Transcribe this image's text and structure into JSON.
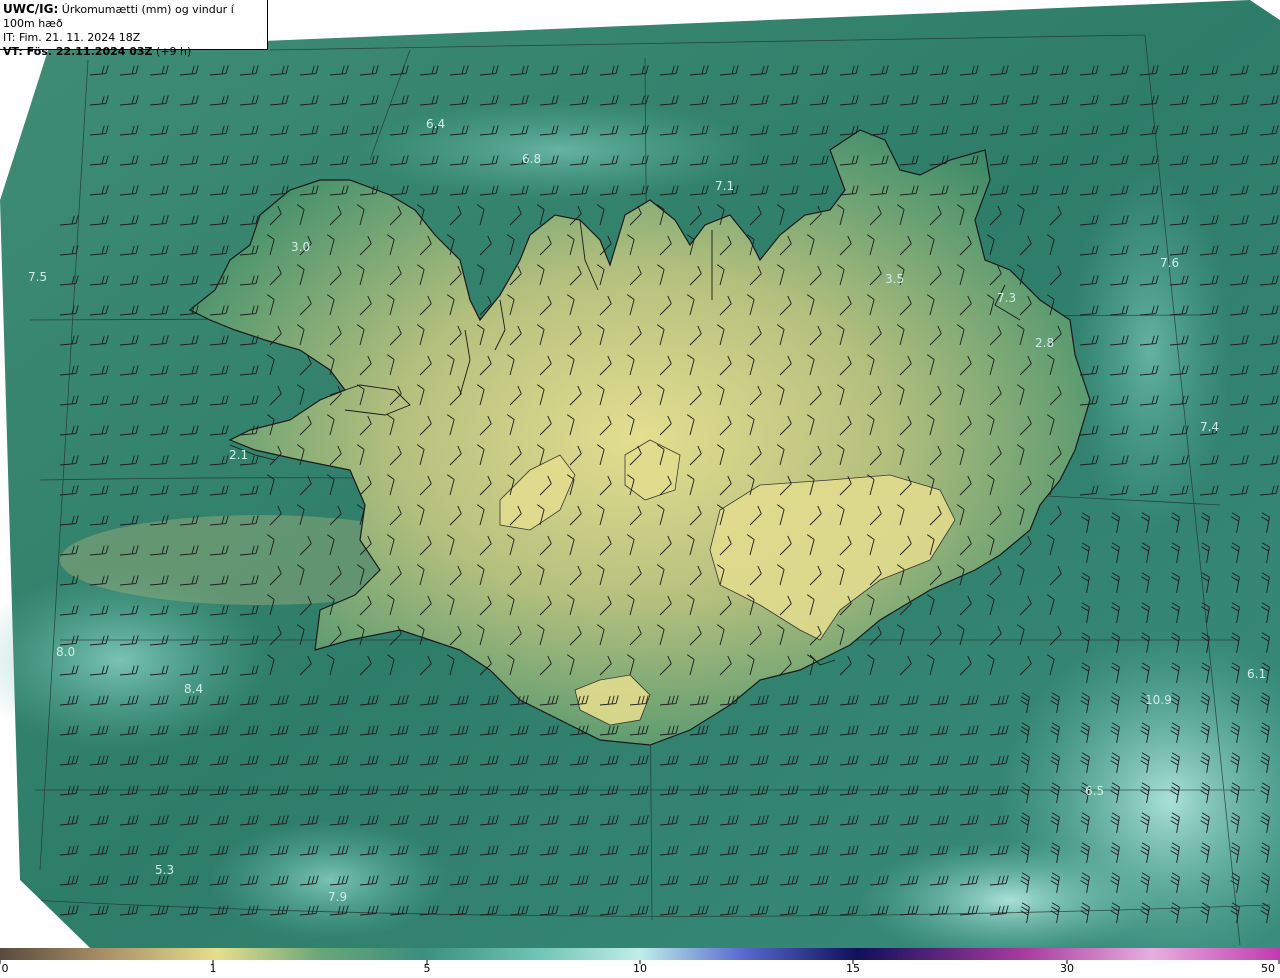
{
  "header": {
    "model": "UWC/IG:",
    "title": "Úrkomumætti (mm) og vindur í 100m hæð",
    "issue_time": "IT: Fim. 21. 11. 2024 18Z",
    "valid_prefix": "VT: Fös. 22.11.2024 03Z",
    "valid_suffix": "(+9 h)"
  },
  "value_labels": [
    "6.4",
    "6.8",
    "7.1",
    "3.0",
    "7.5",
    "3.5",
    "7.6",
    "7.3",
    "2.8",
    "7.4",
    "2.1",
    "8.0",
    "8.4",
    "6.1",
    "10.9",
    "6.5",
    "5.3",
    "7.9"
  ],
  "colorbar": {
    "ticks": [
      "0",
      "1",
      "5",
      "10",
      "15",
      "30",
      "50"
    ],
    "colors": [
      "#5a4a3c",
      "#a88e66",
      "#e6df8c",
      "#4f9c73",
      "#3a8f7e",
      "#bfeee9",
      "#2a2a9a",
      "#100f5a",
      "#a93aa0",
      "#e8aee0"
    ]
  },
  "colors": {
    "sea_dark": "#2f7a66",
    "sea_light": "#8fd4c6",
    "land_low": "#3f8a68",
    "land_high": "#d6d28a",
    "coastline": "#1a1a1a",
    "grid": "#2b3b35"
  }
}
